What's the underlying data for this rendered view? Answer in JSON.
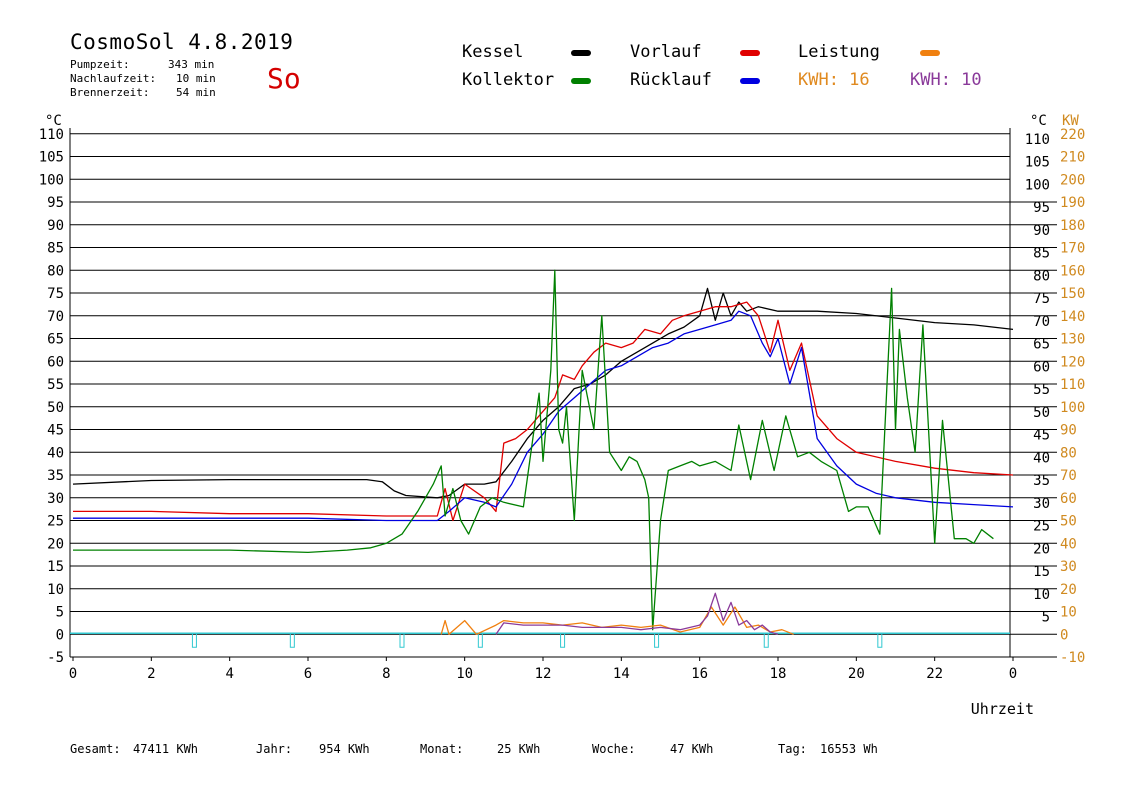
{
  "header": {
    "title": "CosmoSol 4.8.2019",
    "stats": [
      {
        "label": "Pumpzeit:",
        "value": "343 min"
      },
      {
        "label": "Nachlaufzeit:",
        "value": "10 min"
      },
      {
        "label": "Brennerzeit:",
        "value": "54 min"
      }
    ],
    "day": "So"
  },
  "legend": {
    "items": [
      {
        "label": "Kessel",
        "color": "#000000"
      },
      {
        "label": "Vorlauf",
        "color": "#e00000"
      },
      {
        "label": "Leistung",
        "color": "#f08010"
      },
      {
        "label": "Kollektor",
        "color": "#008000"
      },
      {
        "label": "Rücklauf",
        "color": "#0000e0"
      }
    ],
    "kwh1": "KWH: 16",
    "kwh1_color": "#e08a20",
    "kwh2": "KWH: 10",
    "kwh2_color": "#8a3a9a"
  },
  "chart_data": {
    "type": "line",
    "xlabel": "Uhrzeit",
    "ylabel_left": "°C",
    "ylabel_right_temp": "°C",
    "ylabel_right_power": "KW",
    "xlim": [
      0,
      24
    ],
    "ylim": [
      -5,
      110
    ],
    "y2lim": [
      -10,
      220
    ],
    "x_ticks": [
      "0",
      "2",
      "4",
      "6",
      "8",
      "10",
      "12",
      "14",
      "16",
      "18",
      "20",
      "22",
      "0"
    ],
    "y_ticks_left": [
      "-5",
      "0",
      "5",
      "10",
      "15",
      "20",
      "25",
      "30",
      "35",
      "40",
      "45",
      "50",
      "55",
      "60",
      "65",
      "70",
      "75",
      "80",
      "85",
      "90",
      "95",
      "100",
      "105",
      "110"
    ],
    "y_ticks_right_temp": [
      "5",
      "10",
      "15",
      "20",
      "25",
      "30",
      "35",
      "40",
      "45",
      "50",
      "55",
      "60",
      "65",
      "70",
      "75",
      "80",
      "85",
      "90",
      "95",
      "100",
      "105",
      "110"
    ],
    "y_ticks_right_power": [
      "-10",
      "0",
      "10",
      "20",
      "30",
      "40",
      "50",
      "60",
      "70",
      "80",
      "90",
      "100",
      "110",
      "120",
      "130",
      "140",
      "150",
      "160",
      "170",
      "180",
      "190",
      "200",
      "210",
      "220"
    ],
    "grid": true,
    "series": [
      {
        "name": "Kessel",
        "color": "#000000",
        "x": [
          0,
          2,
          4,
          6,
          7.5,
          7.9,
          8.2,
          8.5,
          9.3,
          9.6,
          10,
          10.5,
          10.8,
          11.2,
          11.6,
          12,
          12.4,
          12.8,
          13.2,
          13.6,
          14,
          14.4,
          14.8,
          15.2,
          15.6,
          16,
          16.2,
          16.4,
          16.6,
          16.8,
          17,
          17.2,
          17.5,
          18,
          19,
          20,
          21,
          22,
          23,
          24
        ],
        "y": [
          33,
          33.8,
          34,
          34,
          34,
          33.5,
          31.5,
          30.5,
          30,
          30.5,
          33,
          33,
          33.5,
          38,
          43,
          47,
          50,
          54,
          55,
          57,
          60,
          62,
          64,
          66,
          67.5,
          70,
          76,
          69,
          75,
          70,
          73,
          71,
          72,
          71,
          71,
          70.5,
          69.5,
          68.5,
          68,
          67
        ]
      },
      {
        "name": "Vorlauf",
        "color": "#e00000",
        "x": [
          0,
          2,
          4,
          6,
          8,
          9.3,
          9.5,
          9.7,
          10,
          10.5,
          10.8,
          11,
          11.3,
          11.6,
          12,
          12.3,
          12.5,
          12.8,
          13,
          13.3,
          13.6,
          14,
          14.3,
          14.6,
          15,
          15.3,
          15.6,
          16,
          16.4,
          16.8,
          17.2,
          17.5,
          17.8,
          18,
          18.3,
          18.6,
          19,
          19.5,
          20,
          21,
          22,
          23,
          24
        ],
        "y": [
          27,
          27,
          26.5,
          26.5,
          26,
          26,
          32,
          25,
          33,
          30,
          27,
          42,
          43,
          45,
          49,
          52,
          57,
          56,
          59,
          62,
          64,
          63,
          64,
          67,
          66,
          69,
          70,
          71,
          72,
          72,
          73,
          70,
          62,
          69,
          58,
          64,
          48,
          43,
          40,
          38,
          36.5,
          35.5,
          35
        ]
      },
      {
        "name": "Rücklauf",
        "color": "#0000e0",
        "x": [
          0,
          2,
          4,
          6,
          8,
          9.3,
          9.6,
          10,
          10.5,
          10.8,
          11.2,
          11.6,
          12,
          12.4,
          12.8,
          13.2,
          13.6,
          14,
          14.4,
          14.8,
          15.2,
          15.6,
          16,
          16.4,
          16.8,
          17,
          17.3,
          17.6,
          17.8,
          18,
          18.3,
          18.6,
          19,
          19.5,
          20,
          20.5,
          21,
          22,
          23,
          24
        ],
        "y": [
          25.5,
          25.5,
          25.5,
          25.5,
          25,
          25,
          27,
          30,
          29,
          28,
          33,
          40,
          44,
          49,
          52,
          55,
          58,
          59,
          61,
          63,
          64,
          66,
          67,
          68,
          69,
          71,
          70,
          64,
          61,
          65,
          55,
          63,
          43,
          37,
          33,
          31,
          30,
          29,
          28.5,
          28
        ]
      },
      {
        "name": "Kollektor",
        "color": "#008000",
        "x": [
          0,
          2,
          4,
          6,
          7,
          7.6,
          8,
          8.4,
          8.8,
          9.2,
          9.4,
          9.5,
          9.7,
          9.9,
          10.1,
          10.4,
          10.7,
          11,
          11.5,
          11.9,
          12,
          12.2,
          12.3,
          12.4,
          12.5,
          12.6,
          12.8,
          13,
          13.3,
          13.5,
          13.7,
          14,
          14.2,
          14.4,
          14.6,
          14.7,
          14.8,
          15,
          15.2,
          15.5,
          15.8,
          16,
          16.4,
          16.8,
          17,
          17.3,
          17.6,
          17.9,
          18.2,
          18.5,
          18.8,
          19.1,
          19.5,
          19.8,
          20,
          20.3,
          20.6,
          20.9,
          21,
          21.1,
          21.3,
          21.5,
          21.7,
          22,
          22.2,
          22.5,
          22.8,
          23,
          23.2,
          23.5
        ],
        "y": [
          18.5,
          18.5,
          18.5,
          18,
          18.5,
          19,
          20,
          22,
          27,
          33,
          37,
          26,
          32,
          25,
          22,
          28,
          30,
          29,
          28,
          53,
          38,
          58,
          80,
          45,
          42,
          50,
          25,
          58,
          45,
          70,
          40,
          36,
          39,
          38,
          34,
          30,
          1,
          25,
          36,
          37,
          38,
          37,
          38,
          36,
          46,
          34,
          47,
          36,
          48,
          39,
          40,
          38,
          36,
          27,
          28,
          28,
          22,
          76,
          45,
          67,
          52,
          40,
          68,
          20,
          47,
          21,
          21,
          20,
          23,
          21
        ]
      },
      {
        "name": "Leistung",
        "color": "#f08010",
        "x": [
          9.4,
          9.5,
          9.6,
          10,
          10.3,
          10.8,
          11,
          11.5,
          12,
          12.5,
          13,
          13.5,
          14,
          14.5,
          15,
          15.5,
          16,
          16.3,
          16.6,
          16.9,
          17.2,
          17.5,
          17.8,
          18.1,
          18.4
        ],
        "y": [
          0,
          3,
          0,
          3,
          0,
          2,
          3,
          2.5,
          2.5,
          2,
          2.5,
          1.5,
          2,
          1.5,
          2,
          0.5,
          1.5,
          6,
          2,
          6,
          1.5,
          2,
          0.5,
          1,
          0
        ]
      },
      {
        "name": "KWH: 10",
        "color": "#8a3a9a",
        "x": [
          10.8,
          11,
          11.5,
          12,
          12.5,
          13,
          13.5,
          14,
          14.5,
          15,
          15.5,
          16,
          16.2,
          16.4,
          16.6,
          16.8,
          17,
          17.2,
          17.4,
          17.6,
          17.8,
          18
        ],
        "y": [
          0,
          2.5,
          2,
          2,
          2,
          1.5,
          1.5,
          1.5,
          1,
          1.5,
          1,
          2,
          4,
          9,
          3,
          7,
          2,
          3,
          1,
          2,
          0.5,
          0
        ]
      }
    ]
  },
  "footer": [
    {
      "label": "Gesamt:",
      "value": "47411 KWh"
    },
    {
      "label": "Jahr:",
      "value": "954 KWh"
    },
    {
      "label": "Monat:",
      "value": "25 KWh"
    },
    {
      "label": "Woche:",
      "value": "47 KWh"
    },
    {
      "label": "Tag:",
      "value": "16553 Wh"
    }
  ]
}
